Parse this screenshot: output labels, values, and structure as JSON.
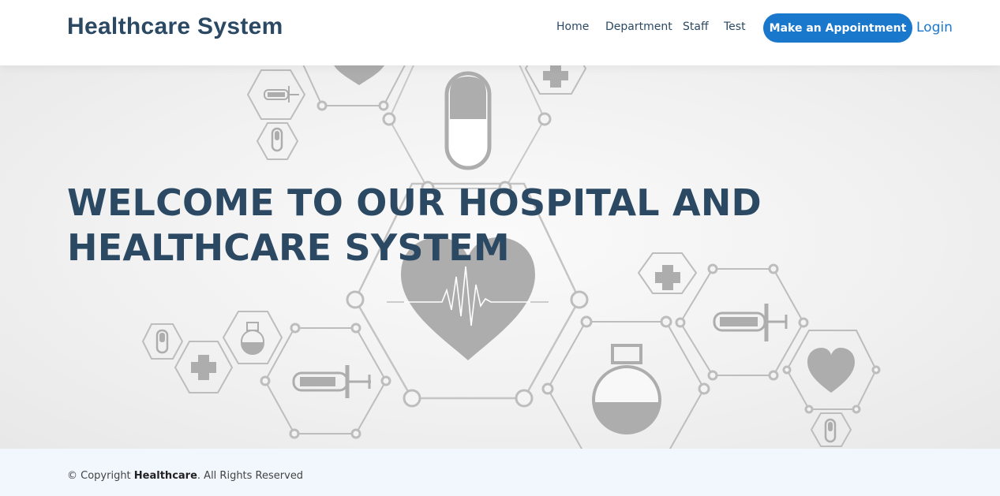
{
  "header": {
    "brand": "Healthcare System",
    "nav": [
      {
        "label": "Home"
      },
      {
        "label": "Department"
      },
      {
        "label": "Staff"
      },
      {
        "label": "Test"
      }
    ],
    "appointment_button": "Make an Appointment",
    "login_link": "Login"
  },
  "hero": {
    "title": "WELCOME TO OUR HOSPITAL AND HEALTHCARE SYSTEM",
    "background_icons": [
      "heart-pulse-icon",
      "capsule-icon",
      "syringe-icon",
      "flask-icon",
      "medical-cross-icon"
    ]
  },
  "footer": {
    "copyright_prefix": "© Copyright ",
    "copyright_brand": "Healthcare",
    "copyright_suffix": ". All Rights Reserved"
  },
  "colors": {
    "primary": "#1977cc",
    "heading": "#2c4964",
    "footer_bg": "#f1f7fd",
    "icon_gray": "#adadad"
  }
}
